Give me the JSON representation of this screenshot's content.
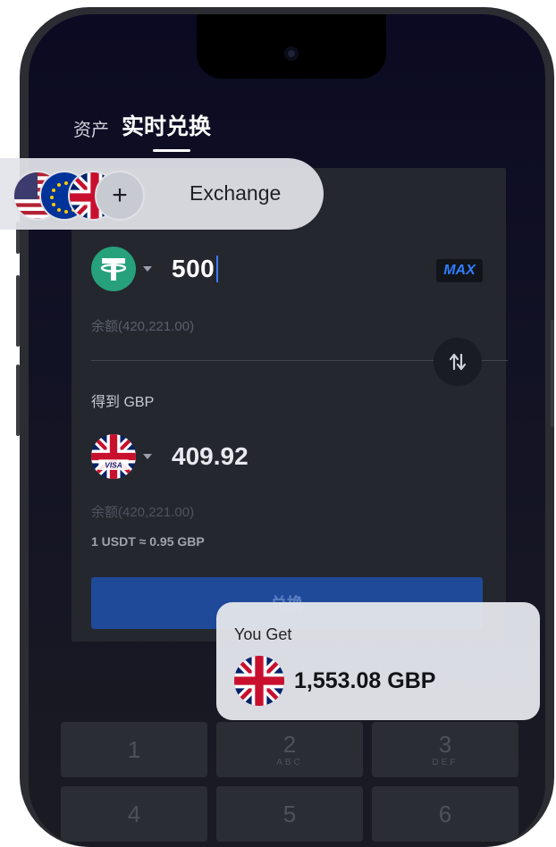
{
  "tabs": {
    "assets": "资产",
    "live_exchange": "实时兑换"
  },
  "from": {
    "token_icon": "tether-icon",
    "amount": "500",
    "max_label": "MAX",
    "balance": "余额(420,221.00)"
  },
  "to": {
    "label": "得到 GBP",
    "token_icon": "uk-flag-visa-icon",
    "amount": "409.92",
    "balance": "余额(420,221.00)"
  },
  "rate": "1 USDT ≈ 0.95 GBP",
  "exchange_button": "兑换",
  "keypad": [
    {
      "num": "1",
      "sub": ""
    },
    {
      "num": "2",
      "sub": "ABC"
    },
    {
      "num": "3",
      "sub": "DEF"
    },
    {
      "num": "4",
      "sub": ""
    },
    {
      "num": "5",
      "sub": ""
    },
    {
      "num": "6",
      "sub": ""
    }
  ],
  "overlay_pill": {
    "flags": [
      "us-flag-icon",
      "eu-flag-icon",
      "uk-flag-icon"
    ],
    "plus": "+",
    "label": "Exchange"
  },
  "toast": {
    "title": "You Get",
    "flag": "uk-flag-icon",
    "amount": "1,553.08 GBP"
  },
  "colors": {
    "accent_blue": "#2f7dff",
    "tether_green": "#26a17b",
    "button_blue": "#1f4a9a"
  }
}
